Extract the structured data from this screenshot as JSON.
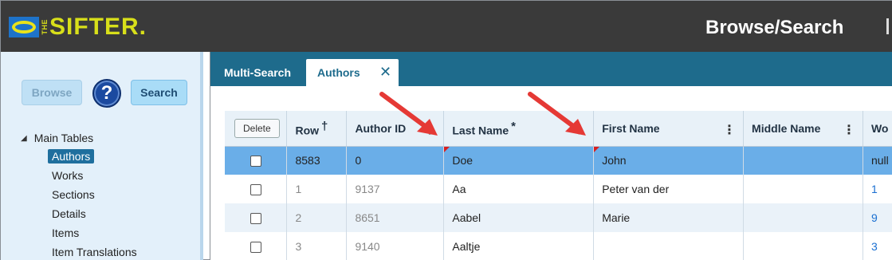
{
  "header": {
    "logo_the": "THE",
    "logo_text": "SIFTER.",
    "page_title": "Browse/Search"
  },
  "sidebar": {
    "browse_label": "Browse",
    "help_label": "?",
    "search_label": "Search",
    "tree": {
      "root": "Main Tables",
      "items": [
        "Authors",
        "Works",
        "Sections",
        "Details",
        "Items",
        "Item Translations"
      ],
      "selected": "Authors"
    }
  },
  "tabs": {
    "multi_search": "Multi-Search",
    "authors": "Authors",
    "close_glyph": "✕"
  },
  "grid": {
    "delete_label": "Delete",
    "columns": {
      "row": "Row",
      "row_mark": "†",
      "author_id": "Author ID",
      "last_name": "Last Name",
      "last_name_mark": "*",
      "first_name": "First Name",
      "middle_name": "Middle Name",
      "works": "Wo"
    },
    "rows": [
      {
        "row": "8583",
        "author_id": "0",
        "last_name": "Doe",
        "first_name": "John",
        "middle_name": "",
        "works": "null"
      },
      {
        "row": "1",
        "author_id": "9137",
        "last_name": "Aa",
        "first_name": "Peter van der",
        "middle_name": "",
        "works": "1"
      },
      {
        "row": "2",
        "author_id": "8651",
        "last_name": "Aabel",
        "first_name": "Marie",
        "middle_name": "",
        "works": "9"
      },
      {
        "row": "3",
        "author_id": "9140",
        "last_name": "Aaltje",
        "first_name": "",
        "middle_name": "",
        "works": "3"
      }
    ]
  },
  "colors": {
    "header_bg": "#3a3a3a",
    "logo_yellow": "#d8df1a",
    "tabbar_bg": "#1e6b8c",
    "new_row": "#6aaee8",
    "arrow_red": "#e53935"
  }
}
